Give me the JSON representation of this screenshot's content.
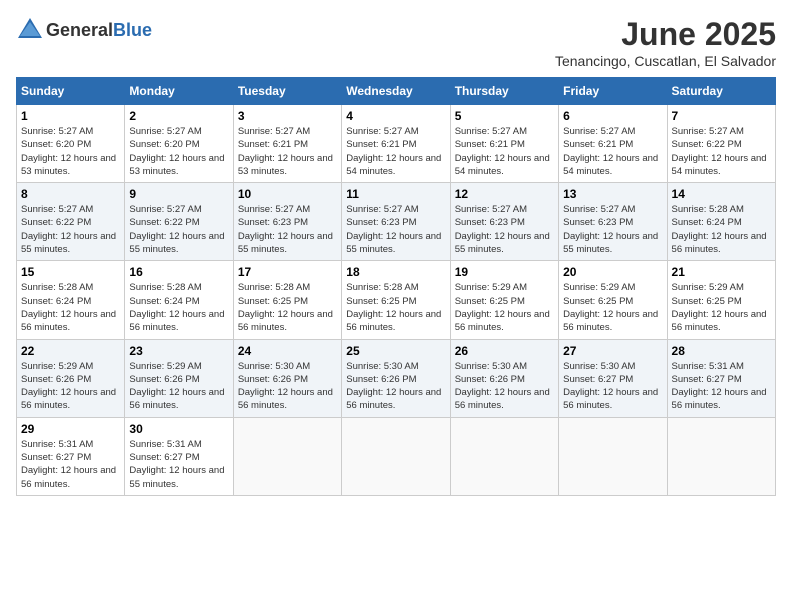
{
  "header": {
    "logo_general": "General",
    "logo_blue": "Blue",
    "month": "June 2025",
    "location": "Tenancingo, Cuscatlan, El Salvador"
  },
  "weekdays": [
    "Sunday",
    "Monday",
    "Tuesday",
    "Wednesday",
    "Thursday",
    "Friday",
    "Saturday"
  ],
  "weeks": [
    [
      {
        "day": "1",
        "sunrise": "5:27 AM",
        "sunset": "6:20 PM",
        "daylight": "12 hours and 53 minutes."
      },
      {
        "day": "2",
        "sunrise": "5:27 AM",
        "sunset": "6:20 PM",
        "daylight": "12 hours and 53 minutes."
      },
      {
        "day": "3",
        "sunrise": "5:27 AM",
        "sunset": "6:21 PM",
        "daylight": "12 hours and 53 minutes."
      },
      {
        "day": "4",
        "sunrise": "5:27 AM",
        "sunset": "6:21 PM",
        "daylight": "12 hours and 54 minutes."
      },
      {
        "day": "5",
        "sunrise": "5:27 AM",
        "sunset": "6:21 PM",
        "daylight": "12 hours and 54 minutes."
      },
      {
        "day": "6",
        "sunrise": "5:27 AM",
        "sunset": "6:21 PM",
        "daylight": "12 hours and 54 minutes."
      },
      {
        "day": "7",
        "sunrise": "5:27 AM",
        "sunset": "6:22 PM",
        "daylight": "12 hours and 54 minutes."
      }
    ],
    [
      {
        "day": "8",
        "sunrise": "5:27 AM",
        "sunset": "6:22 PM",
        "daylight": "12 hours and 55 minutes."
      },
      {
        "day": "9",
        "sunrise": "5:27 AM",
        "sunset": "6:22 PM",
        "daylight": "12 hours and 55 minutes."
      },
      {
        "day": "10",
        "sunrise": "5:27 AM",
        "sunset": "6:23 PM",
        "daylight": "12 hours and 55 minutes."
      },
      {
        "day": "11",
        "sunrise": "5:27 AM",
        "sunset": "6:23 PM",
        "daylight": "12 hours and 55 minutes."
      },
      {
        "day": "12",
        "sunrise": "5:27 AM",
        "sunset": "6:23 PM",
        "daylight": "12 hours and 55 minutes."
      },
      {
        "day": "13",
        "sunrise": "5:27 AM",
        "sunset": "6:23 PM",
        "daylight": "12 hours and 55 minutes."
      },
      {
        "day": "14",
        "sunrise": "5:28 AM",
        "sunset": "6:24 PM",
        "daylight": "12 hours and 56 minutes."
      }
    ],
    [
      {
        "day": "15",
        "sunrise": "5:28 AM",
        "sunset": "6:24 PM",
        "daylight": "12 hours and 56 minutes."
      },
      {
        "day": "16",
        "sunrise": "5:28 AM",
        "sunset": "6:24 PM",
        "daylight": "12 hours and 56 minutes."
      },
      {
        "day": "17",
        "sunrise": "5:28 AM",
        "sunset": "6:25 PM",
        "daylight": "12 hours and 56 minutes."
      },
      {
        "day": "18",
        "sunrise": "5:28 AM",
        "sunset": "6:25 PM",
        "daylight": "12 hours and 56 minutes."
      },
      {
        "day": "19",
        "sunrise": "5:29 AM",
        "sunset": "6:25 PM",
        "daylight": "12 hours and 56 minutes."
      },
      {
        "day": "20",
        "sunrise": "5:29 AM",
        "sunset": "6:25 PM",
        "daylight": "12 hours and 56 minutes."
      },
      {
        "day": "21",
        "sunrise": "5:29 AM",
        "sunset": "6:25 PM",
        "daylight": "12 hours and 56 minutes."
      }
    ],
    [
      {
        "day": "22",
        "sunrise": "5:29 AM",
        "sunset": "6:26 PM",
        "daylight": "12 hours and 56 minutes."
      },
      {
        "day": "23",
        "sunrise": "5:29 AM",
        "sunset": "6:26 PM",
        "daylight": "12 hours and 56 minutes."
      },
      {
        "day": "24",
        "sunrise": "5:30 AM",
        "sunset": "6:26 PM",
        "daylight": "12 hours and 56 minutes."
      },
      {
        "day": "25",
        "sunrise": "5:30 AM",
        "sunset": "6:26 PM",
        "daylight": "12 hours and 56 minutes."
      },
      {
        "day": "26",
        "sunrise": "5:30 AM",
        "sunset": "6:26 PM",
        "daylight": "12 hours and 56 minutes."
      },
      {
        "day": "27",
        "sunrise": "5:30 AM",
        "sunset": "6:27 PM",
        "daylight": "12 hours and 56 minutes."
      },
      {
        "day": "28",
        "sunrise": "5:31 AM",
        "sunset": "6:27 PM",
        "daylight": "12 hours and 56 minutes."
      }
    ],
    [
      {
        "day": "29",
        "sunrise": "5:31 AM",
        "sunset": "6:27 PM",
        "daylight": "12 hours and 56 minutes."
      },
      {
        "day": "30",
        "sunrise": "5:31 AM",
        "sunset": "6:27 PM",
        "daylight": "12 hours and 55 minutes."
      },
      null,
      null,
      null,
      null,
      null
    ]
  ]
}
